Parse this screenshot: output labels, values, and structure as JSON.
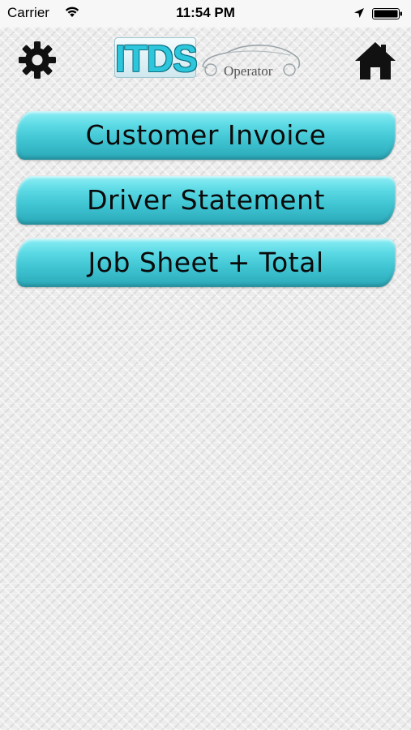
{
  "status_bar": {
    "carrier": "Carrier",
    "time": "11:54 PM"
  },
  "header": {
    "settings_icon": "gear-icon",
    "home_icon": "home-icon",
    "logo": {
      "brand": "ITDS",
      "subtitle": "Operator"
    }
  },
  "menu": {
    "items": [
      {
        "label": "Customer Invoice"
      },
      {
        "label": "Driver Statement"
      },
      {
        "label": "Job Sheet + Total"
      }
    ]
  },
  "colors": {
    "button_accent": "#4fd3df",
    "logo_accent": "#2cc7dc"
  }
}
